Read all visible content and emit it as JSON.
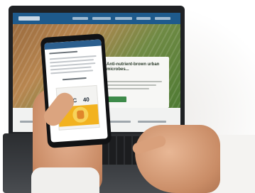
{
  "laptop": {
    "hero_title": "Anti-nutrient-brown urban microbes..."
  },
  "phone": {
    "product_name": "UREC",
    "product_number": "40"
  }
}
